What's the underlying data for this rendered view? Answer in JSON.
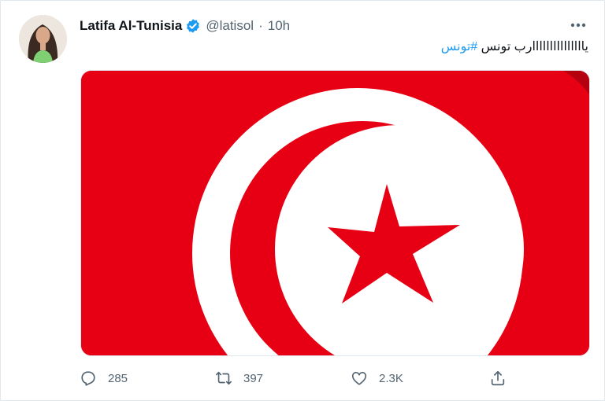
{
  "tweet": {
    "author_name": "Latifa Al-Tunisia",
    "handle": "@latisol",
    "separator": "·",
    "time": "10h",
    "text_prefix": "يااااااااااااااارب تونس ",
    "hashtag": "#تونس",
    "verified": true
  },
  "media": {
    "image": "tunisia-flag",
    "flag_red": "#e70013",
    "flag_white": "#ffffff"
  },
  "actions": {
    "reply_count": "285",
    "retweet_count": "397",
    "like_count": "2.3K"
  },
  "colors": {
    "accent": "#1d9bf0",
    "muted": "#536471",
    "text": "#0f1419"
  },
  "icons": [
    "verified-badge-icon",
    "more-icon",
    "reply-icon",
    "retweet-icon",
    "like-icon",
    "share-icon"
  ]
}
